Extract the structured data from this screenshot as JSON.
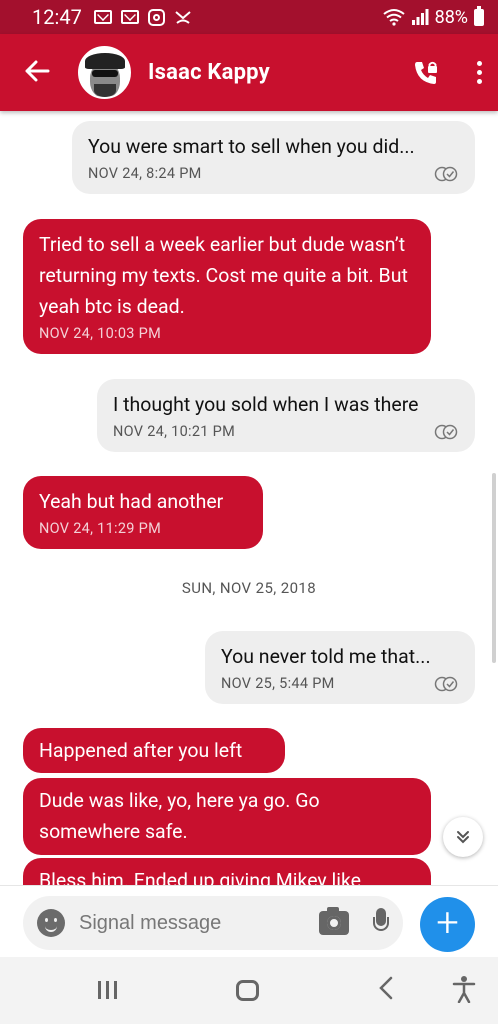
{
  "status_bar": {
    "time": "12:47",
    "battery": "88%"
  },
  "header": {
    "contact_name": "Isaac Kappy",
    "icons": [
      "back-arrow-icon",
      "avatar",
      "secure-call-icon",
      "more-options-icon"
    ]
  },
  "messages": [
    {
      "direction": "out",
      "text": "You were smart to sell when you did...",
      "timestamp": "NOV 24, 8:24 PM"
    },
    {
      "direction": "in",
      "text": "Tried to sell a week earlier but dude wasn’t returning my texts. Cost me quite a bit. But yeah btc is dead.",
      "timestamp": "NOV 24, 10:03 PM"
    },
    {
      "direction": "out",
      "text": "I thought you sold when I was there",
      "timestamp": "NOV 24, 10:21 PM"
    },
    {
      "direction": "in",
      "text": "Yeah but had another",
      "timestamp": "NOV 24, 11:29 PM"
    },
    {
      "direction": "out",
      "text": "You never told me that...",
      "timestamp": "NOV 25, 5:44 PM"
    },
    {
      "direction": "in",
      "text": "Happened after you left"
    },
    {
      "direction": "in",
      "text": "Dude was like, yo, here ya go. Go somewhere safe."
    },
    {
      "direction": "in",
      "text": "Bless him. Ended up giving Mikey like"
    }
  ],
  "date_separator": "SUN, NOV 25, 2018",
  "composer": {
    "placeholder": "Signal message",
    "send_label": "+"
  },
  "colors": {
    "accent": "#c8102e",
    "status_bar": "#a3102d",
    "outgoing_bubble": "#eeeeee",
    "send_button": "#2090ea"
  }
}
